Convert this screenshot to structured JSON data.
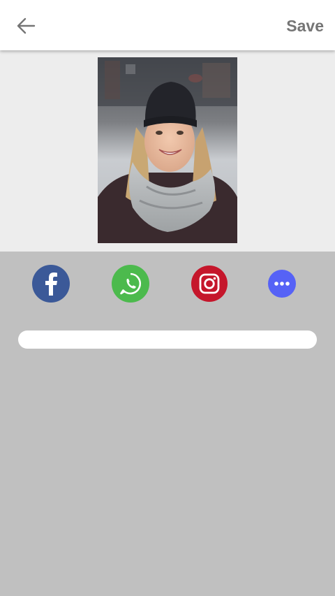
{
  "toolbar": {
    "back_icon": "arrow-left-icon",
    "save_label": "Save"
  },
  "preview": {
    "image": "photo-woman-beanie-scarf"
  },
  "share": {
    "targets": [
      {
        "icon": "facebook-icon",
        "color": "#3b5998"
      },
      {
        "icon": "whatsapp-icon",
        "color": "#4cba4d"
      },
      {
        "icon": "instagram-icon",
        "color": "#c5162b"
      },
      {
        "icon": "more-options-icon",
        "color": "#5662f6"
      }
    ]
  },
  "progress": {
    "value": 0
  },
  "colors": {
    "topbar_bg": "#ffffff",
    "icon_gray": "#757575",
    "preview_bg": "#ededed",
    "panel_bg": "#c0c0c0",
    "track": "#ffffff",
    "fill": "#4a90e2"
  }
}
